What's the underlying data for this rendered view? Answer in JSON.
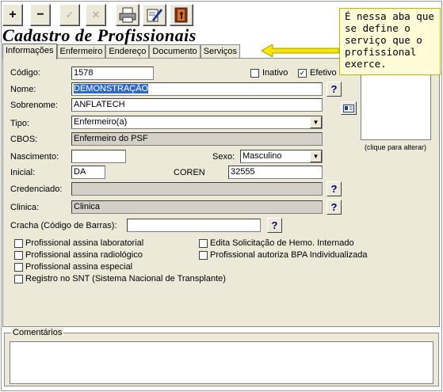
{
  "toolbar": {
    "add": "+",
    "remove": "−",
    "confirm": "✓",
    "cancel": "✕"
  },
  "title": "Cadastro de Profissionais",
  "tabs": [
    "Informações",
    "Enfermeiro",
    "Endereço",
    "Documento",
    "Serviços"
  ],
  "callout": "É nessa aba que se define o serviço que o profissional exerce.",
  "form": {
    "codigo_label": "Código:",
    "codigo": "1578",
    "inativo_label": "Inativo",
    "efetivo_label": "Efetivo",
    "nome_label": "Nome:",
    "nome": "DEMONSTRAÇÃO",
    "sobrenome_label": "Sobrenome:",
    "sobrenome": "ANFLATECH",
    "tipo_label": "Tipo:",
    "tipo": "Enfermeiro(a)",
    "cbos_label": "CBOS:",
    "cbos": "Enfermeiro do PSF",
    "nascimento_label": "Nascimento:",
    "nascimento": "",
    "sexo_label": "Sexo:",
    "sexo": "Masculino",
    "inicial_label": "Inicial:",
    "inicial": "DA",
    "coren_label": "COREN",
    "coren": "32555",
    "credenciado_label": "Credenciado:",
    "credenciado": "",
    "clinica_label": "Clinica:",
    "clinica": "Clinica",
    "cracha_label": "Cracha (Código de Barras):",
    "cracha": "",
    "help": "?",
    "photo_hint": "(clique para alterar)"
  },
  "checkboxes": {
    "lab": "Profissional assina laboratorial",
    "radio": "Profissional assina radiológico",
    "especial": "Profissional assina especial",
    "snt": "Registro no SNT (Sistema Nacional de Transplante)",
    "hemo": "Edita Solicitação de Hemo. Internado",
    "bpa": "Profissional autoriza BPA Individualizada"
  },
  "comments_label": "Comentários"
}
